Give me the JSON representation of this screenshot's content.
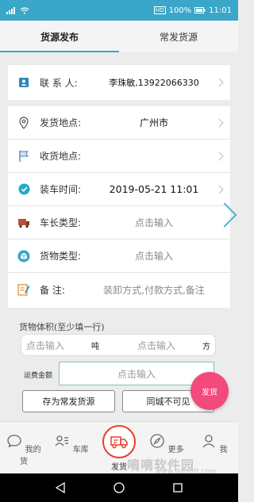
{
  "status_bar": {
    "battery": "100%",
    "time": "11:01",
    "network": "HD"
  },
  "tabs": [
    {
      "label": "货源发布",
      "active": true
    },
    {
      "label": "常发货源",
      "active": false
    }
  ],
  "form": {
    "contact": {
      "label": "联 系 人:",
      "value": "李珠敏,13922066330"
    },
    "origin": {
      "label": "发货地点:",
      "value": "广州市"
    },
    "destination": {
      "label": "收货地点:",
      "value": ""
    },
    "load_time": {
      "label": "装车时间:",
      "value": "2019-05-21 11:01"
    },
    "truck_length": {
      "label": "车长类型:",
      "placeholder": "点击输入"
    },
    "cargo_type": {
      "label": "货物类型:",
      "placeholder": "点击输入"
    },
    "remarks": {
      "label": "备    注:",
      "placeholder": "装卸方式,付款方式,备注"
    }
  },
  "volume": {
    "title": "货物体积(至少填一行)",
    "weight_placeholder": "点击输入",
    "weight_unit": "吨",
    "cubic_placeholder": "点击输入",
    "cubic_unit": "方"
  },
  "fee": {
    "label": "运费金额",
    "placeholder": "点击输入"
  },
  "buttons": {
    "save_frequent": "存为常发货源",
    "city_invisible": "同城不可见",
    "publish": "发货"
  },
  "bottom_nav": [
    {
      "label": "我的货",
      "icon": "chat-bubble-icon"
    },
    {
      "label": "车库",
      "icon": "contacts-icon"
    },
    {
      "label": "发货",
      "icon": "truck-icon"
    },
    {
      "label": "更多",
      "icon": "compass-icon"
    },
    {
      "label": "我",
      "icon": "person-icon"
    }
  ],
  "watermark": {
    "cn": "嘀嘀软件园",
    "url": "www.ddisoft.com"
  },
  "colors": {
    "accent": "#3aa7c9",
    "publish": "#f24a7c",
    "center_nav": "#e6402c"
  }
}
